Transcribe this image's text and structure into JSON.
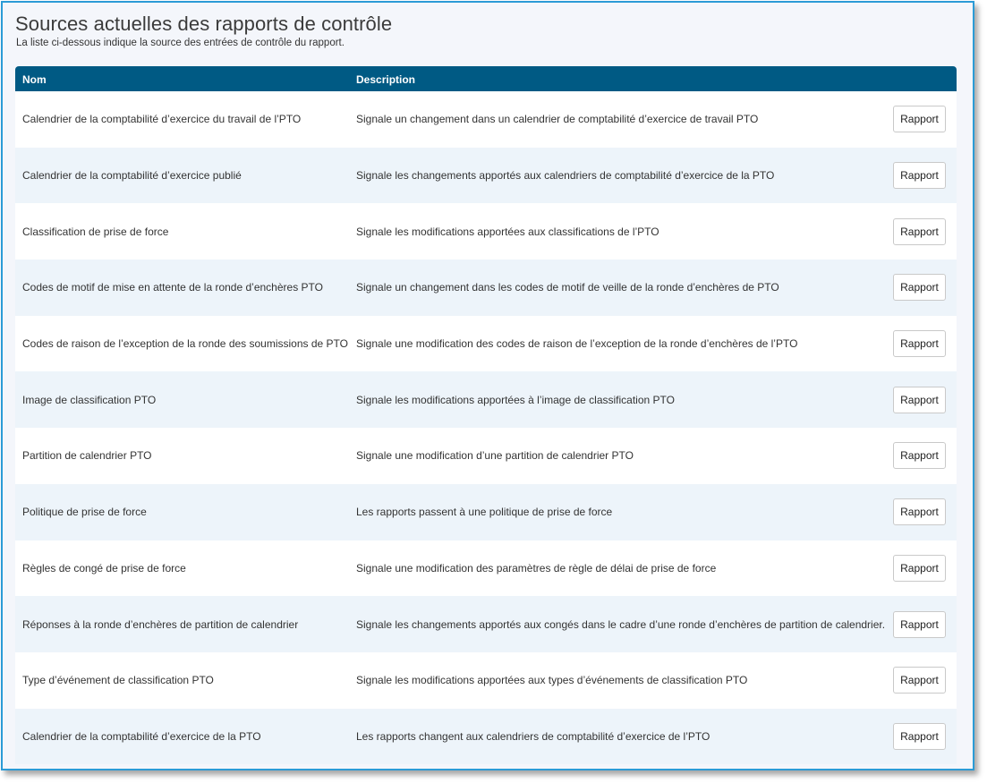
{
  "page": {
    "title": "Sources actuelles des rapports de contrôle",
    "subtitle": "La liste ci-dessous indique la source des entrées de contrôle du rapport."
  },
  "table": {
    "headers": {
      "name": "Nom",
      "description": "Description"
    },
    "rows": [
      {
        "name": "Calendrier de la comptabilité d’exercice du travail de l’PTO",
        "description": "Signale un changement dans un calendrier de comptabilité d’exercice de travail PTO",
        "button": "Rapport"
      },
      {
        "name": "Calendrier de la comptabilité d’exercice publié",
        "description": "Signale les changements apportés aux calendriers de comptabilité d’exercice de la PTO",
        "button": "Rapport"
      },
      {
        "name": "Classification de prise de force",
        "description": "Signale les modifications apportées aux classifications de l’PTO",
        "button": "Rapport"
      },
      {
        "name": "Codes de motif de mise en attente de la ronde d’enchères PTO",
        "description": "Signale un changement dans les codes de motif de veille de la ronde d’enchères de PTO",
        "button": "Rapport"
      },
      {
        "name": "Codes de raison de l’exception de la ronde des soumissions de PTO",
        "description": "Signale une modification des codes de raison de l’exception de la ronde d’enchères de l’PTO",
        "button": "Rapport"
      },
      {
        "name": "Image de classification PTO",
        "description": "Signale les modifications apportées à l’image de classification PTO",
        "button": "Rapport"
      },
      {
        "name": "Partition de calendrier PTO",
        "description": "Signale une modification d’une partition de calendrier PTO",
        "button": "Rapport"
      },
      {
        "name": "Politique de prise de force",
        "description": "Les rapports passent à une politique de prise de force",
        "button": "Rapport"
      },
      {
        "name": "Règles de congé de prise de force",
        "description": "Signale une modification des paramètres de règle de délai de prise de force",
        "button": "Rapport"
      },
      {
        "name": "Réponses à la ronde d’enchères de partition de calendrier",
        "description": "Signale les changements apportés aux congés dans le cadre d’une ronde d’enchères de partition de calendrier.",
        "button": "Rapport"
      },
      {
        "name": "Type d’événement de classification PTO",
        "description": "Signale les modifications apportées aux types d’événements de classification PTO",
        "button": "Rapport"
      },
      {
        "name": "Calendrier de la comptabilité d’exercice de la PTO",
        "description": "Les rapports changent aux calendriers de comptabilité d’exercice de l’PTO",
        "button": "Rapport"
      }
    ]
  },
  "colors": {
    "header_bg": "#005a84",
    "frame_border": "#2b9bd6",
    "row_alt": "#edf4fa"
  }
}
